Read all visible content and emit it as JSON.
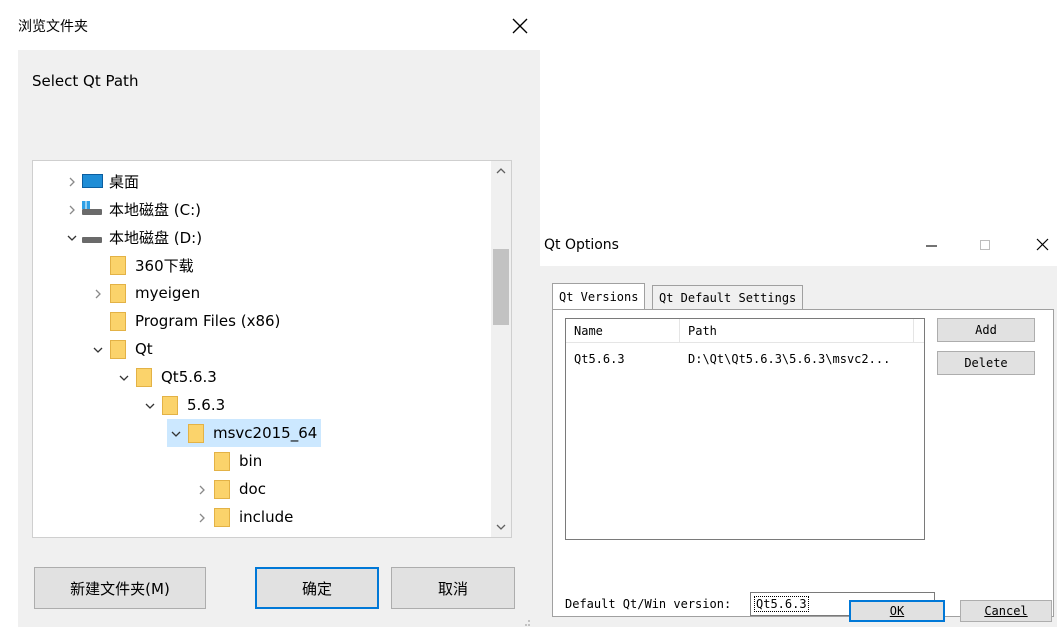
{
  "browse_dialog": {
    "title": "浏览文件夹",
    "prompt": "Select Qt Path",
    "tree": [
      {
        "label": "桌面",
        "icon": "desktop-icon",
        "expander": "collapsed",
        "depth": 0
      },
      {
        "label": "本地磁盘 (C:)",
        "icon": "windows-drive-icon",
        "expander": "collapsed",
        "depth": 0
      },
      {
        "label": "本地磁盘 (D:)",
        "icon": "drive-icon",
        "expander": "expanded",
        "depth": 0
      },
      {
        "label": "360下载",
        "icon": "folder-icon",
        "expander": "none",
        "depth": 1
      },
      {
        "label": "myeigen",
        "icon": "folder-icon",
        "expander": "collapsed",
        "depth": 1
      },
      {
        "label": "Program Files (x86)",
        "icon": "folder-icon",
        "expander": "none",
        "depth": 1
      },
      {
        "label": "Qt",
        "icon": "folder-icon",
        "expander": "expanded",
        "depth": 1
      },
      {
        "label": "Qt5.6.3",
        "icon": "folder-icon",
        "expander": "expanded",
        "depth": 2
      },
      {
        "label": "5.6.3",
        "icon": "folder-icon",
        "expander": "expanded",
        "depth": 3
      },
      {
        "label": "msvc2015_64",
        "icon": "folder-icon",
        "expander": "expanded",
        "depth": 4,
        "selected": true
      },
      {
        "label": "bin",
        "icon": "folder-icon",
        "expander": "none",
        "depth": 5
      },
      {
        "label": "doc",
        "icon": "folder-icon",
        "expander": "collapsed",
        "depth": 5
      },
      {
        "label": "include",
        "icon": "folder-icon",
        "expander": "collapsed",
        "depth": 5
      }
    ],
    "buttons": {
      "new_folder": "新建文件夹(M)",
      "ok": "确定",
      "cancel": "取消"
    }
  },
  "qt_options": {
    "title": "Qt Options",
    "tabs": [
      "Qt Versions",
      "Qt Default Settings"
    ],
    "active_tab": 0,
    "columns": [
      "Name",
      "Path"
    ],
    "rows": [
      {
        "name": "Qt5.6.3",
        "path": "D:\\Qt\\Qt5.6.3\\5.6.3\\msvc2..."
      }
    ],
    "add_label": "Add",
    "delete_label": "Delete",
    "default_version_label": "Default Qt/Win version:",
    "default_version_value": "Qt5.6.3",
    "ok_label": "OK",
    "cancel_label": "Cancel"
  },
  "colors": {
    "selection": "#cce8ff",
    "accent": "#0078d7",
    "folder": "#fbd36b",
    "dialog_bg": "#f0f0f0"
  }
}
